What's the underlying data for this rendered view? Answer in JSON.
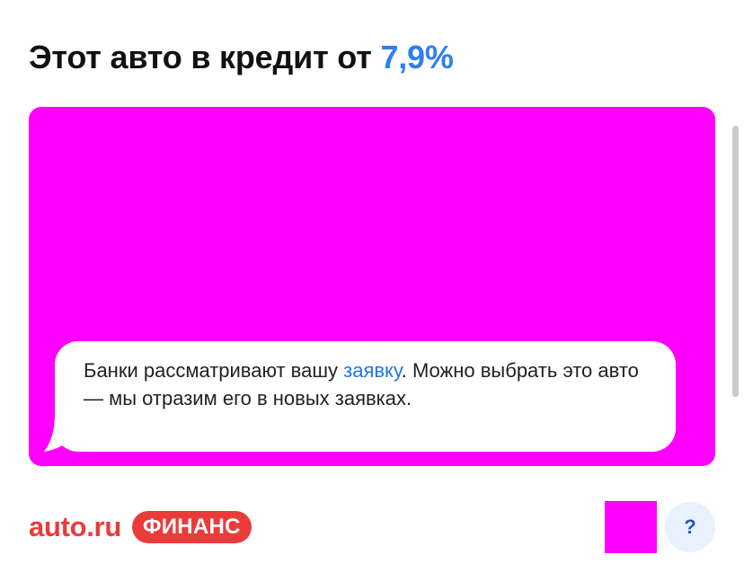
{
  "header": {
    "title_prefix": "Этот авто в кредит от",
    "title_rate": "7,9%"
  },
  "banner": {
    "background_color": "#ff00ff",
    "message_before_link": "Банки рассматривают вашу ",
    "message_link": "заявку",
    "message_after_link": ". Можно выбрать это авто — мы отразим его в новых заявках."
  },
  "footer": {
    "brand_name": "auto.ru",
    "brand_badge": "ФИНАНС",
    "help_label": "?"
  },
  "colors": {
    "accent": "#2e7ff1",
    "brand_red": "#ea3b3b",
    "help_button_bg": "#e8f1fd"
  },
  "icons": {
    "speech_bubble": "speech-bubble-tail-icon",
    "help": "question-mark-icon"
  }
}
